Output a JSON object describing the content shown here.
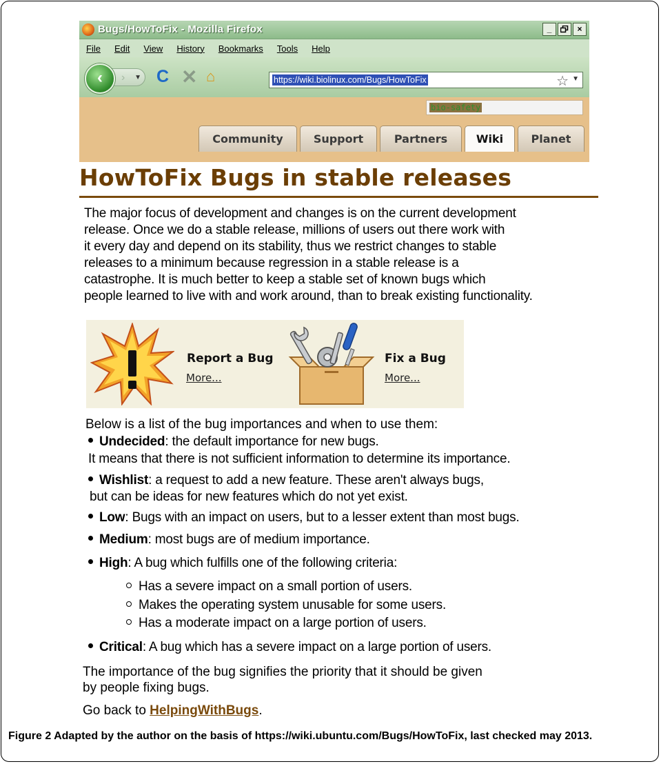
{
  "browser": {
    "title": "Bugs/HowToFix - Mozilla Firefox",
    "window_buttons": [
      "_",
      "×"
    ],
    "menu": [
      "File",
      "Edit",
      "View",
      "History",
      "Bookmarks",
      "Tools",
      "Help"
    ],
    "url": "https://wiki.biolinux.com/Bugs/HowToFix",
    "search_value": "bio-safety",
    "tabs": [
      "Community",
      "Support",
      "Partners",
      "Wiki",
      "Planet"
    ],
    "active_tab": "Wiki"
  },
  "page": {
    "title": "HowToFix Bugs in stable releases",
    "intro": [
      "The major focus of development and changes is on the current development",
      "release. Once we do a stable release, millions of users out there work with",
      "it every day and depend on its stability, thus we restrict changes to stable",
      "releases to a minimum because regression in a stable release is a",
      "catastrophe. It is much better to keep a stable set of known bugs which",
      "people learned to live with and work around, than to break existing functionality."
    ],
    "banner": {
      "report_label": "Report a Bug",
      "report_link": "More...",
      "fix_label": "Fix a Bug",
      "fix_link": "More..."
    },
    "list_intro": "Below is a list of the bug importances and when to use them:",
    "importances": {
      "undecided_name": "Undecided",
      "undecided_desc": ": the default importance for new bugs.",
      "undecided_cont": "It means that there is not sufficient information to determine its importance.",
      "wishlist_name": "Wishlist",
      "wishlist_desc": ": a request to add a new feature. These aren't always bugs,",
      "wishlist_cont": "but can be ideas for new features which do not yet exist.",
      "low_name": "Low",
      "low_desc": ": Bugs with an impact on users, but to a lesser extent than most bugs.",
      "medium_name": "Medium",
      "medium_desc": ": most bugs are of medium importance.",
      "high_name": "High",
      "high_desc": ": A bug which fulfills one of the following criteria:",
      "high_criteria": [
        "Has a severe impact on a small portion of users.",
        "Makes the operating system unusable for some users.",
        "Has a moderate impact on a large portion of users."
      ],
      "critical_name": "Critical",
      "critical_desc": ": A bug which has a severe impact on a large portion of users."
    },
    "closing": [
      "The importance of the bug signifies the priority that it should be given",
      "by people fixing bugs."
    ],
    "go_back_prefix": "Go back to ",
    "go_back_link": "HelpingWithBugs",
    "go_back_suffix": "."
  },
  "caption": {
    "bold": "Figure 2 Adapted by the author on the basis of https://wiki.ubuntu.com/Bugs/HowToFix, last checked may 2013."
  },
  "colors": {
    "heading": "#6b3e05",
    "link": "#7a4a0c",
    "banner_bg": "#f3f0df",
    "titlebar": "#8dbb8a"
  }
}
